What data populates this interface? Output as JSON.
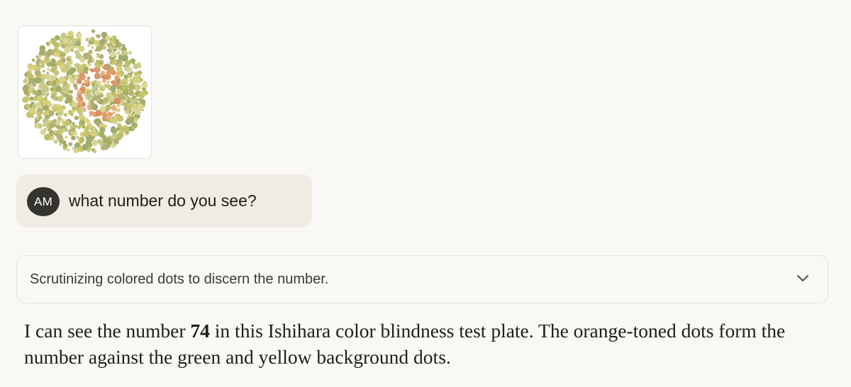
{
  "attachment": {
    "alt": "Ishihara color plate image",
    "colors": {
      "background_dots": [
        "#c8c46e",
        "#b9bd64",
        "#d6cf7c",
        "#a6ad5e",
        "#9fab70",
        "#c2c98a",
        "#b3b07a",
        "#d9d598"
      ],
      "figure_dots": [
        "#e0a06a",
        "#d99060",
        "#e6b080",
        "#d49a6c"
      ]
    }
  },
  "user_message": {
    "avatar_initials": "AM",
    "text": "what number do you see?"
  },
  "thinking": {
    "summary": "Scrutinizing colored dots to discern the number.",
    "toggle_icon": "chevron-down-icon"
  },
  "answer": {
    "prefix": "I can see the number ",
    "number": "74",
    "suffix": " in this Ishihara color blindness test plate. The orange-toned dots form the number against the green and yellow background dots."
  }
}
